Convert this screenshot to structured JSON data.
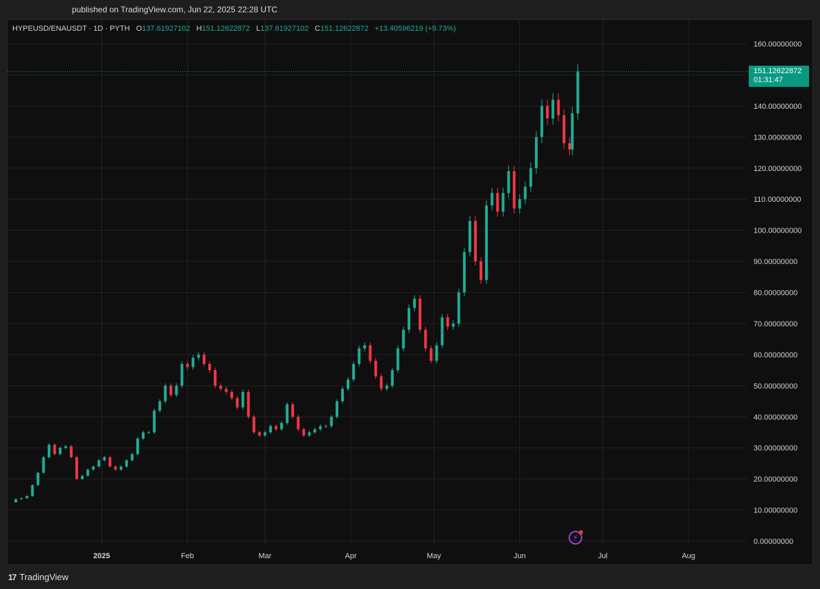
{
  "header": {
    "published": "published on TradingView.com, Jun 22, 2025 22:28 UTC"
  },
  "legend": {
    "symbol": "HYPEUSD/ENAUSDT · 1D · PYTH",
    "o_label": "O",
    "o": "137.61927102",
    "h_label": "H",
    "h": "151.12622872",
    "l_label": "L",
    "l": "137.61927102",
    "c_label": "C",
    "c": "151.12622872",
    "change": "+13.40596219 (+9.73%)"
  },
  "price_tag": {
    "price": "151.12622872",
    "countdown": "01:31:47"
  },
  "footer": {
    "brand": "TradingView",
    "brand_mark": "17"
  },
  "colors": {
    "up": "#22ab94",
    "down": "#f23645",
    "grid": "#232323",
    "axis_text": "#d1d4dc",
    "background": "#0f0f0f",
    "last_price": "#089981"
  },
  "chart_data": {
    "type": "candlestick",
    "title": "",
    "xlabel": "",
    "ylabel": "",
    "ylim": [
      0,
      160
    ],
    "y_ticks": [
      "0.00000000",
      "10.00000000",
      "20.00000000",
      "30.00000000",
      "40.00000000",
      "50.00000000",
      "60.00000000",
      "70.00000000",
      "80.00000000",
      "90.00000000",
      "100.00000000",
      "110.00000000",
      "120.00000000",
      "130.00000000",
      "140.00000000",
      "150.00000000",
      "160.00000000"
    ],
    "x_ticks": [
      {
        "date": "2025-01-01",
        "label": "2025",
        "bold": true
      },
      {
        "date": "2025-02-01",
        "label": "Feb"
      },
      {
        "date": "2025-03-01",
        "label": "Mar"
      },
      {
        "date": "2025-04-01",
        "label": "Apr"
      },
      {
        "date": "2025-05-01",
        "label": "May"
      },
      {
        "date": "2025-06-01",
        "label": "Jun"
      },
      {
        "date": "2025-07-01",
        "label": "Jul"
      },
      {
        "date": "2025-08-01",
        "label": "Aug"
      }
    ],
    "x_start": "2024-11-28",
    "x_end": "2025-08-22",
    "last_price": 151.12622872,
    "close_series": [
      [
        "2024-12-01",
        13.5
      ],
      [
        "2024-12-03",
        13.8
      ],
      [
        "2024-12-05",
        14.5
      ],
      [
        "2024-12-07",
        18
      ],
      [
        "2024-12-09",
        22
      ],
      [
        "2024-12-11",
        27
      ],
      [
        "2024-12-13",
        31
      ],
      [
        "2024-12-15",
        28
      ],
      [
        "2024-12-17",
        30
      ],
      [
        "2024-12-19",
        30.5
      ],
      [
        "2024-12-21",
        27
      ],
      [
        "2024-12-23",
        20
      ],
      [
        "2024-12-25",
        21
      ],
      [
        "2024-12-27",
        23
      ],
      [
        "2024-12-29",
        24
      ],
      [
        "2024-12-31",
        26
      ],
      [
        "2025-01-02",
        27
      ],
      [
        "2025-01-04",
        24
      ],
      [
        "2025-01-06",
        23
      ],
      [
        "2025-01-08",
        24
      ],
      [
        "2025-01-10",
        26
      ],
      [
        "2025-01-12",
        28
      ],
      [
        "2025-01-14",
        33
      ],
      [
        "2025-01-16",
        35
      ],
      [
        "2025-01-18",
        35
      ],
      [
        "2025-01-20",
        42
      ],
      [
        "2025-01-22",
        45
      ],
      [
        "2025-01-24",
        50
      ],
      [
        "2025-01-26",
        47
      ],
      [
        "2025-01-28",
        50
      ],
      [
        "2025-01-30",
        57
      ],
      [
        "2025-02-01",
        56
      ],
      [
        "2025-02-03",
        59
      ],
      [
        "2025-02-05",
        60
      ],
      [
        "2025-02-07",
        57
      ],
      [
        "2025-02-09",
        55
      ],
      [
        "2025-02-11",
        50
      ],
      [
        "2025-02-13",
        49
      ],
      [
        "2025-02-15",
        48
      ],
      [
        "2025-02-17",
        46
      ],
      [
        "2025-02-19",
        43
      ],
      [
        "2025-02-21",
        48
      ],
      [
        "2025-02-23",
        40
      ],
      [
        "2025-02-25",
        35
      ],
      [
        "2025-02-27",
        34
      ],
      [
        "2025-03-01",
        35
      ],
      [
        "2025-03-03",
        37
      ],
      [
        "2025-03-05",
        36
      ],
      [
        "2025-03-07",
        38
      ],
      [
        "2025-03-09",
        44
      ],
      [
        "2025-03-11",
        40
      ],
      [
        "2025-03-13",
        36
      ],
      [
        "2025-03-15",
        34
      ],
      [
        "2025-03-17",
        35
      ],
      [
        "2025-03-19",
        36
      ],
      [
        "2025-03-21",
        37
      ],
      [
        "2025-03-23",
        37
      ],
      [
        "2025-03-25",
        40
      ],
      [
        "2025-03-27",
        45
      ],
      [
        "2025-03-29",
        49
      ],
      [
        "2025-03-31",
        52
      ],
      [
        "2025-04-02",
        57
      ],
      [
        "2025-04-04",
        62
      ],
      [
        "2025-04-06",
        63
      ],
      [
        "2025-04-08",
        58
      ],
      [
        "2025-04-10",
        53
      ],
      [
        "2025-04-12",
        49
      ],
      [
        "2025-04-14",
        50
      ],
      [
        "2025-04-16",
        55
      ],
      [
        "2025-04-18",
        62
      ],
      [
        "2025-04-20",
        68
      ],
      [
        "2025-04-22",
        75
      ],
      [
        "2025-04-24",
        78
      ],
      [
        "2025-04-26",
        68
      ],
      [
        "2025-04-28",
        62
      ],
      [
        "2025-04-30",
        58
      ],
      [
        "2025-05-02",
        63
      ],
      [
        "2025-05-04",
        72
      ],
      [
        "2025-05-06",
        69
      ],
      [
        "2025-05-08",
        70
      ],
      [
        "2025-05-10",
        80
      ],
      [
        "2025-05-12",
        93
      ],
      [
        "2025-05-14",
        103
      ],
      [
        "2025-05-16",
        90
      ],
      [
        "2025-05-18",
        84
      ],
      [
        "2025-05-20",
        108
      ],
      [
        "2025-05-22",
        112
      ],
      [
        "2025-05-24",
        106
      ],
      [
        "2025-05-26",
        112
      ],
      [
        "2025-05-28",
        119
      ],
      [
        "2025-05-30",
        107
      ],
      [
        "2025-06-01",
        110
      ],
      [
        "2025-06-03",
        114
      ],
      [
        "2025-06-05",
        120
      ],
      [
        "2025-06-07",
        130
      ],
      [
        "2025-06-09",
        140
      ],
      [
        "2025-06-11",
        136
      ],
      [
        "2025-06-13",
        142
      ],
      [
        "2025-06-15",
        137
      ],
      [
        "2025-06-17",
        128
      ],
      [
        "2025-06-19",
        126
      ],
      [
        "2025-06-20",
        137.62
      ],
      [
        "2025-06-22",
        151.13
      ]
    ]
  }
}
